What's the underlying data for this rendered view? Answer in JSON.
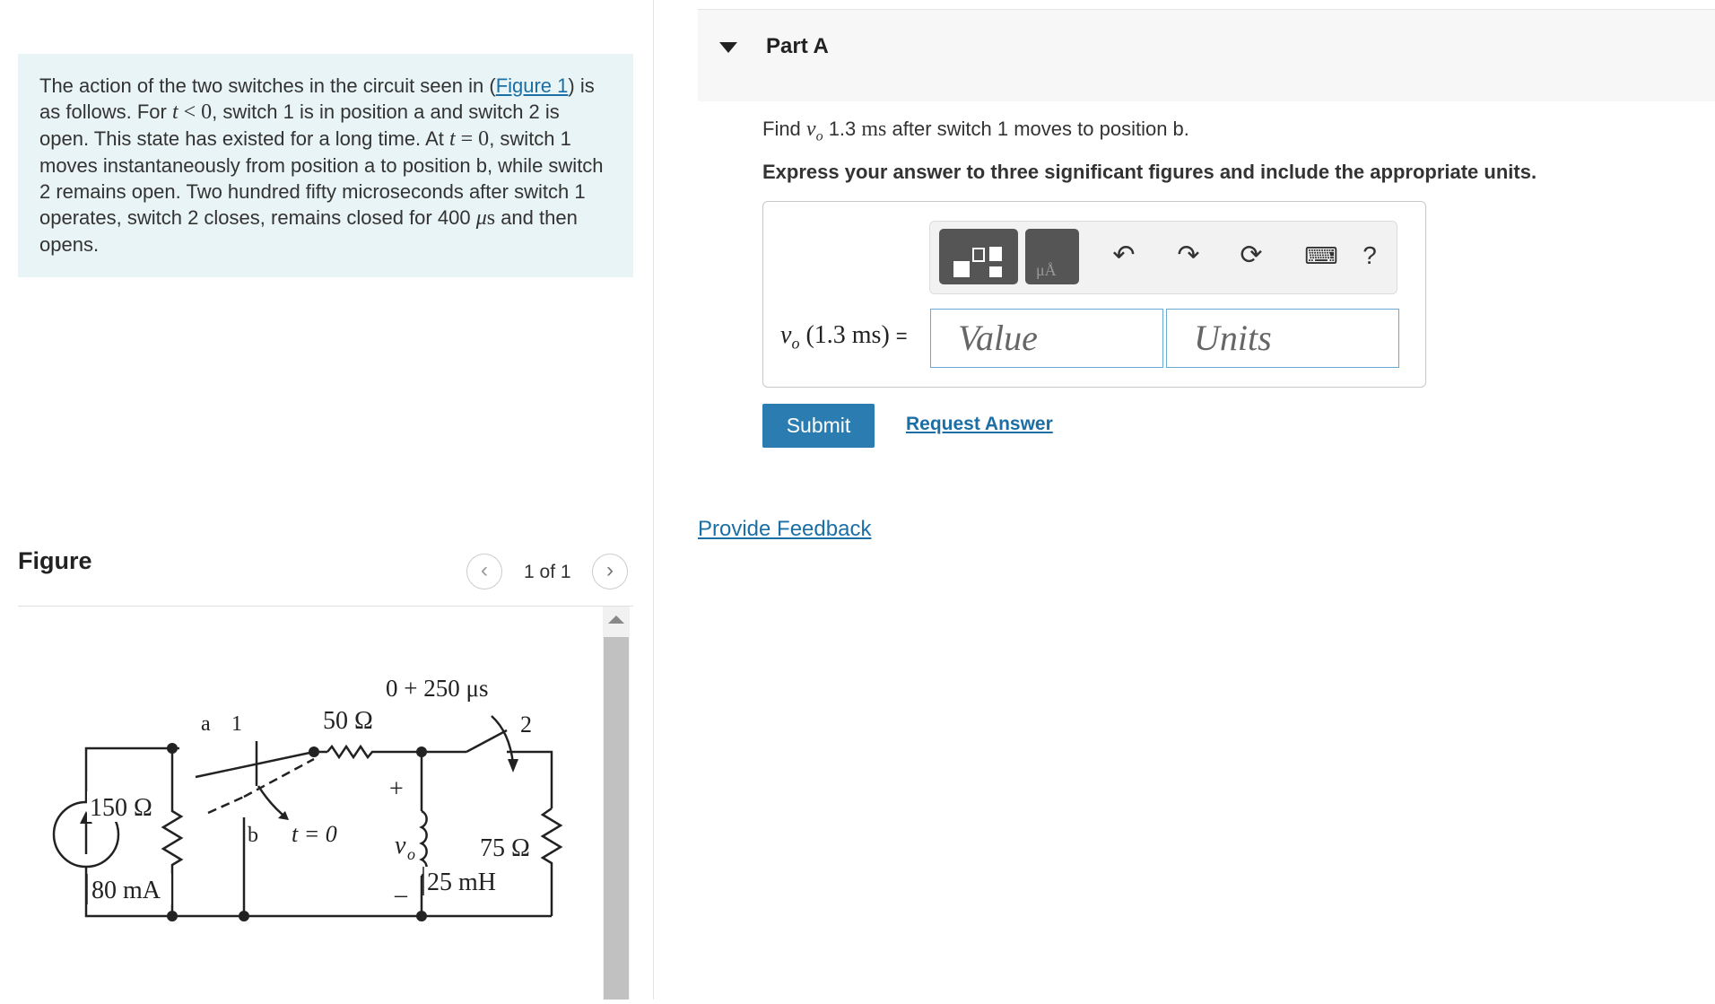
{
  "problem": {
    "segments": [
      {
        "t": "The action of the two switches in the circuit seen in ("
      },
      {
        "t": "Figure 1",
        "link": true
      },
      {
        "t": ") is as follows. For "
      },
      {
        "t": "t",
        "math": true
      },
      {
        "t": " < 0",
        "mathplain": true
      },
      {
        "t": ", switch 1 is in position a and switch 2 is open. This state has existed for a long time. At "
      },
      {
        "t": "t",
        "math": true
      },
      {
        "t": " = 0",
        "mathplain": true
      },
      {
        "t": ", switch 1 moves instantaneously from position a to position b, while switch 2 remains open. Two hundred fifty microseconds after switch 1 operates, switch 2 closes, remains closed for 400 "
      },
      {
        "t": "μ",
        "math": true
      },
      {
        "t": "s",
        "mathplain": true
      },
      {
        "t": " and then opens."
      }
    ]
  },
  "figure": {
    "header": "Figure",
    "pager_text": "1 of 1",
    "prev_icon": "chevron-left-icon",
    "next_icon": "chevron-right-icon",
    "circuit_labels": {
      "r150": "150 Ω",
      "src": "80 mA",
      "a": "a",
      "one": "1",
      "b": "b",
      "t0": "t = 0",
      "r50": "50 Ω",
      "t250": "0 + 250 μs",
      "two": "2",
      "plus": "+",
      "vo": "v",
      "vo_sub": "o",
      "minus": "–",
      "r75": "75 Ω",
      "l25": "25 mH"
    }
  },
  "part": {
    "title": "Part A",
    "caret_icon": "caret-down-icon",
    "question_prefix": "Find ",
    "question_var": "v",
    "question_sub": "o",
    "question_mid": " 1.3 ",
    "question_unit": "ms",
    "question_suffix": " after switch 1 moves to position b.",
    "instruction": "Express your answer to three significant figures and include the appropriate units."
  },
  "answer": {
    "label_var": "v",
    "label_sub": "o",
    "label_arg": "(1.3 ms)",
    "label_eq": "=",
    "value_placeholder": "Value",
    "units_placeholder": "Units",
    "toolbar": {
      "templates_icon": "templates-icon",
      "units_icon": "units-icon",
      "units_glyph": "μÅ",
      "undo_icon": "undo-icon",
      "redo_icon": "redo-icon",
      "reset_icon": "reset-icon",
      "keyboard_icon": "keyboard-icon",
      "help_label": "?"
    },
    "submit_label": "Submit",
    "request_label": "Request Answer"
  },
  "feedback_label": "Provide Feedback",
  "colors": {
    "problem_bg": "#e8f4f5",
    "link": "#1b6fa5",
    "submit_bg": "#2b7db1",
    "toolbar_btn": "#555555"
  }
}
